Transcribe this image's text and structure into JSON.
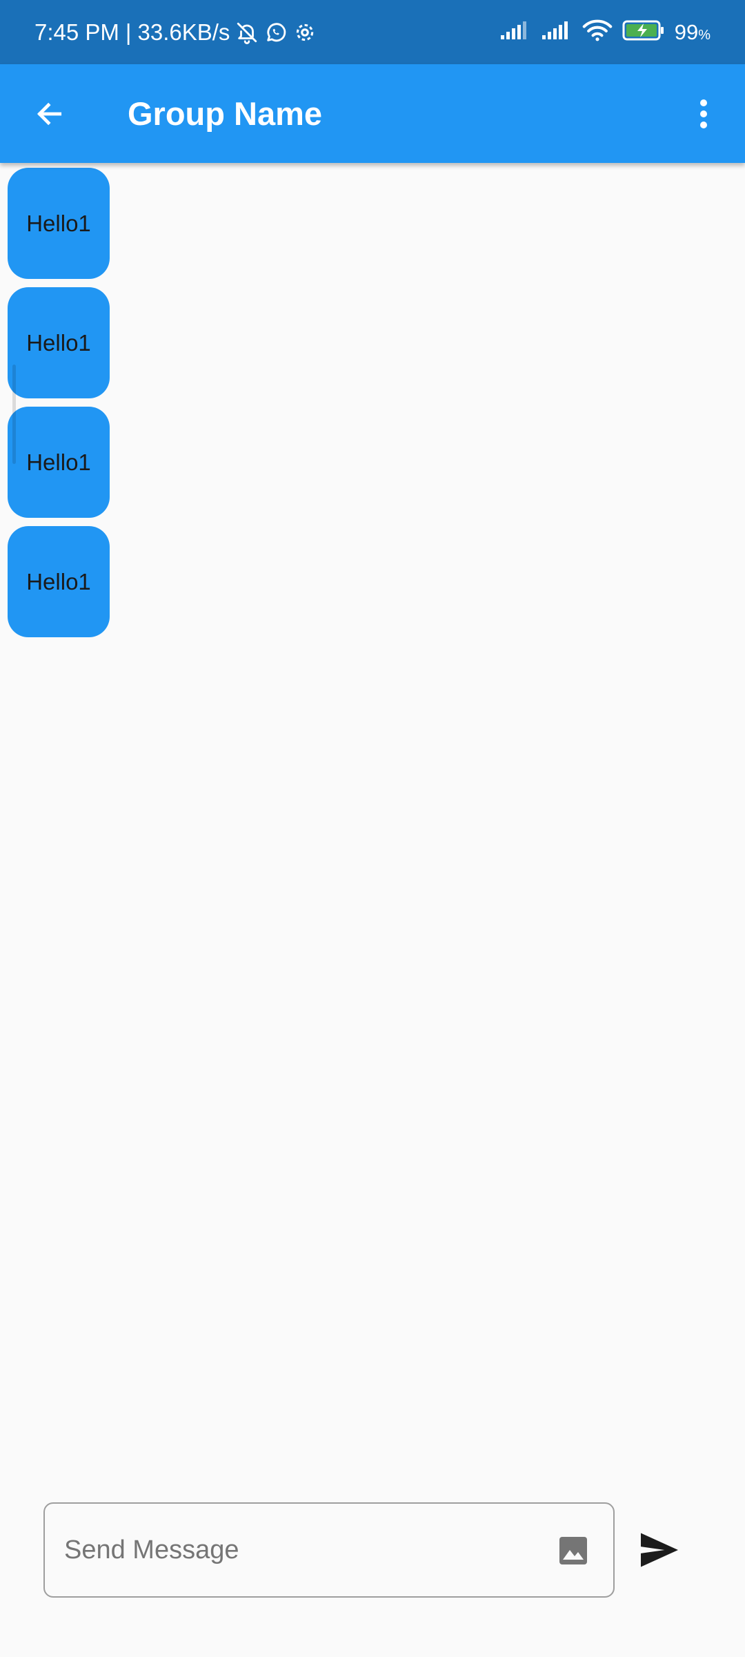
{
  "status_bar": {
    "time": "7:45 PM",
    "separator": "|",
    "net_speed": "33.6KB/s",
    "battery_percent": "99",
    "battery_unit": "%",
    "icons": [
      "bell-off-icon",
      "whatsapp-icon",
      "settings-icon",
      "signal-icon",
      "signal-icon",
      "wifi-icon",
      "battery-charging-icon"
    ]
  },
  "app_bar": {
    "title": "Group Name",
    "back_icon": "arrow-left-icon",
    "menu_icon": "more-vert-icon",
    "color": "#2196f3"
  },
  "messages": [
    {
      "text": "Hello1"
    },
    {
      "text": "Hello1"
    },
    {
      "text": "Hello1"
    },
    {
      "text": "Hello1"
    }
  ],
  "composer": {
    "placeholder": "Send Message",
    "value": "",
    "image_icon": "image-icon",
    "send_icon": "send-icon"
  },
  "colors": {
    "status_bar": "#1a70b8",
    "accent": "#2196f3",
    "background": "#fafafa"
  }
}
